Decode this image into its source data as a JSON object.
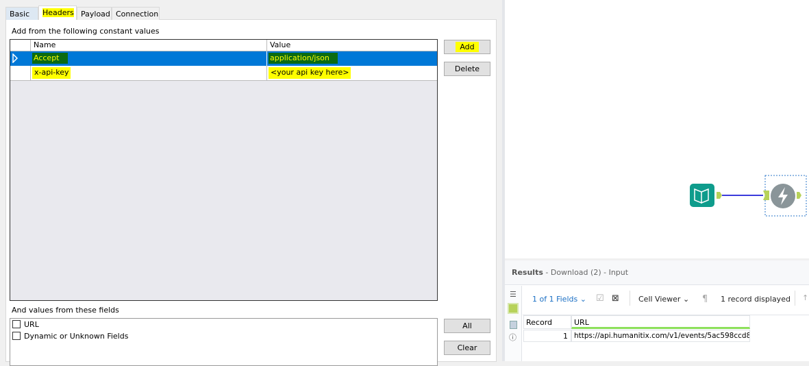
{
  "tabs": [
    "Basic",
    "Headers",
    "Payload",
    "Connection"
  ],
  "headers_section": {
    "label": "Add from the following constant values",
    "columns": [
      "Name",
      "Value"
    ],
    "rows": [
      {
        "name": "Accept",
        "value": "application/json"
      },
      {
        "name": "x-api-key",
        "value": "<your api key here>"
      }
    ]
  },
  "buttons": {
    "add": "Add",
    "delete": "Delete",
    "all": "All",
    "clear": "Clear"
  },
  "fields_section": {
    "label": "And values from these fields",
    "items": [
      "URL",
      "Dynamic or Unknown Fields"
    ]
  },
  "results": {
    "title": "Results",
    "subtitle": " - Download (2) - Input",
    "fields_dropdown": "1 of 1 Fields",
    "viewer": "Cell Viewer",
    "record_count": "1 record displayed",
    "columns": [
      "Record",
      "URL"
    ],
    "rows": [
      {
        "record": "1",
        "url": "https://api.humanitix.com/v1/events/5ac598ccd8..."
      }
    ]
  },
  "colors": {
    "selection": "#0078d7",
    "connector": "#3b3bdc",
    "tool_green": "#0e9c8c",
    "anchor": "#b7d25a"
  }
}
